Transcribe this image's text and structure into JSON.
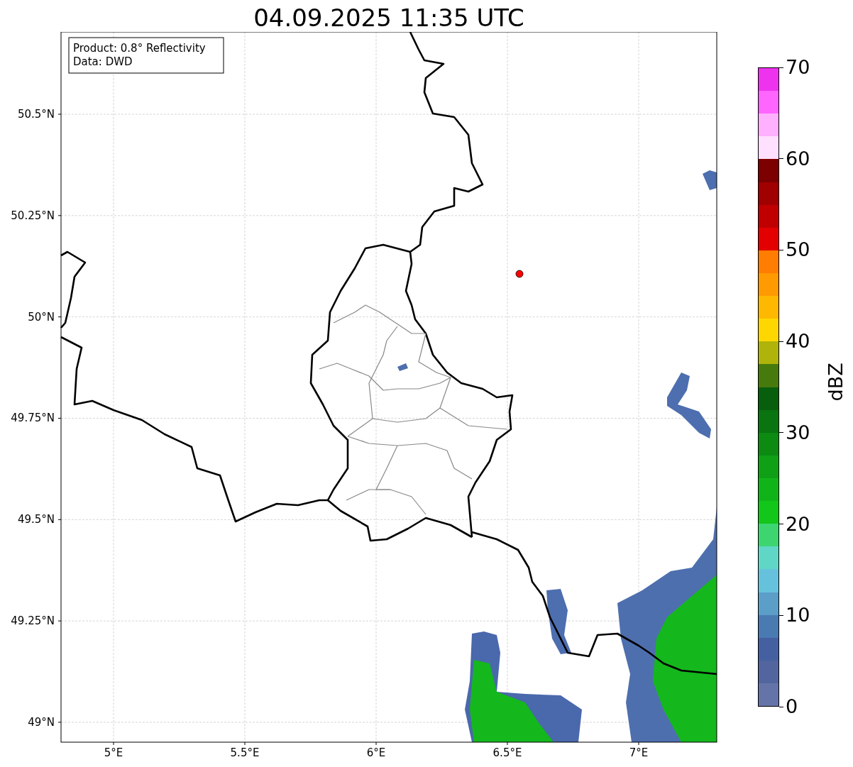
{
  "title": "04.09.2025 11:35 UTC",
  "info_box": {
    "lines": [
      "Product: 0.8° Reflectivity",
      "Data: DWD"
    ]
  },
  "map": {
    "lat_labels": [
      "50.5°N",
      "50.25°N",
      "50°N",
      "49.75°N",
      "49.5°N",
      "49.25°N",
      "49°N"
    ],
    "lon_labels": [
      "5°E",
      "5.5°E",
      "6°E",
      "6.5°E",
      "7°E"
    ]
  },
  "colorbar": {
    "label": "dBZ",
    "ticks": [
      "70",
      "60",
      "50",
      "40",
      "30",
      "20",
      "10",
      "0"
    ],
    "bins": [
      {
        "color": "#ee33ee"
      },
      {
        "color": "#ff66ff"
      },
      {
        "color": "#ffb0ff"
      },
      {
        "color": "#ffe0ff"
      },
      {
        "color": "#7c0000"
      },
      {
        "color": "#a00000"
      },
      {
        "color": "#c00000"
      },
      {
        "color": "#e30000"
      },
      {
        "color": "#ff7d00"
      },
      {
        "color": "#ff9a00"
      },
      {
        "color": "#ffb800"
      },
      {
        "color": "#ffd700"
      },
      {
        "color": "#b0b40a"
      },
      {
        "color": "#477a0c"
      },
      {
        "color": "#075e0c"
      },
      {
        "color": "#0a7410"
      },
      {
        "color": "#0c8a12"
      },
      {
        "color": "#0fa016"
      },
      {
        "color": "#11b418"
      },
      {
        "color": "#12c61a"
      },
      {
        "color": "#3cd570"
      },
      {
        "color": "#5fd6c6"
      },
      {
        "color": "#66c2dc"
      },
      {
        "color": "#5b9ec8"
      },
      {
        "color": "#4a7ab2"
      },
      {
        "color": "#4460a0"
      },
      {
        "color": "#52659e"
      },
      {
        "color": "#6474a8"
      }
    ]
  }
}
